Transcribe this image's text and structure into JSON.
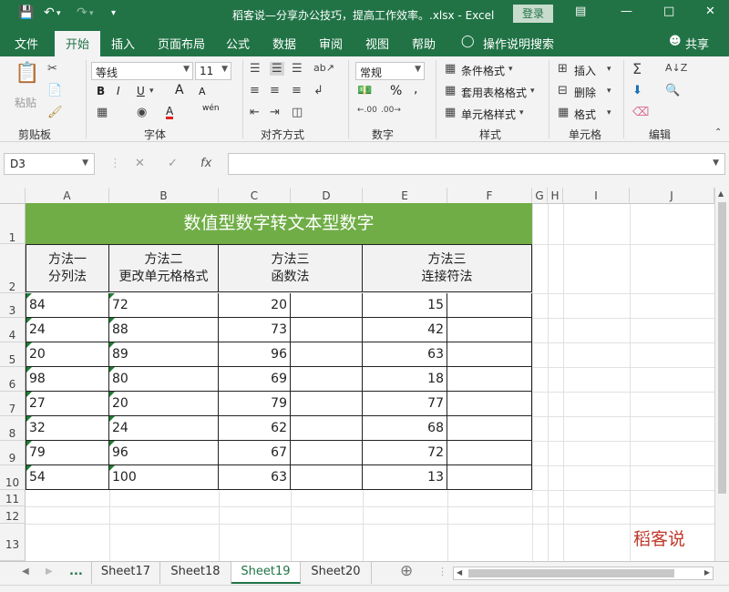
{
  "titlebar": {
    "title": "稻客说—分享办公技巧，提高工作效率。.xlsx  -  Excel",
    "login": "登录"
  },
  "tabs": [
    "文件",
    "开始",
    "插入",
    "页面布局",
    "公式",
    "数据",
    "审阅",
    "视图",
    "帮助",
    "操作说明搜索",
    "共享"
  ],
  "ribbon": {
    "paste_label": "粘贴",
    "font_name": "等线",
    "font_size": "11",
    "bold": "B",
    "italic": "I",
    "underline": "U",
    "grow_font": "A",
    "shrink_font": "A",
    "font_color": "A",
    "phonetic": "wén",
    "number_format": "常规",
    "percent": "%",
    "comma": ",",
    "conditional_format": "条件格式",
    "table_format": "套用表格格式",
    "cell_style": "单元格样式",
    "insert": "插入",
    "delete": "删除",
    "format": "格式",
    "groups": {
      "clipboard": "剪贴板",
      "font": "字体",
      "alignment": "对齐方式",
      "number": "数字",
      "styles": "样式",
      "cells": "单元格",
      "editing": "编辑"
    }
  },
  "formula_bar": {
    "name_box": "D3",
    "fx": "fx",
    "value": ""
  },
  "columns": [
    "A",
    "B",
    "C",
    "D",
    "E",
    "F",
    "G",
    "H",
    "I",
    "J"
  ],
  "rows": [
    "1",
    "2",
    "3",
    "4",
    "5",
    "6",
    "7",
    "8",
    "9",
    "10",
    "11",
    "12",
    "13"
  ],
  "sheet": {
    "banner": "数值型数字转文本型数字",
    "headers": {
      "m1_line1": "方法一",
      "m1_line2": "分列法",
      "m2_line1": "方法二",
      "m2_line2": "更改单元格格式",
      "m3_line1": "方法三",
      "m3_line2": "函数法",
      "m4_line1": "方法三",
      "m4_line2": "连接符法"
    },
    "col_a": [
      "84",
      "24",
      "20",
      "98",
      "27",
      "32",
      "79",
      "54"
    ],
    "col_b": [
      "72",
      "88",
      "89",
      "80",
      "20",
      "24",
      "96",
      "100"
    ],
    "col_c": [
      "20",
      "73",
      "96",
      "69",
      "79",
      "62",
      "67",
      "63"
    ],
    "col_e": [
      "15",
      "42",
      "63",
      "18",
      "77",
      "68",
      "72",
      "13"
    ],
    "watermark": "稻客说"
  },
  "sheet_tabs": [
    "Sheet17",
    "Sheet18",
    "Sheet19",
    "Sheet20"
  ],
  "active_sheet": "Sheet19",
  "sheet_nav_more": "...",
  "colors": {
    "excel_green": "#217346",
    "banner_green": "#70ad47",
    "header_fill": "#f2f2f2",
    "text_indicator": "#1e7e34",
    "watermark_red": "#c0392b"
  }
}
